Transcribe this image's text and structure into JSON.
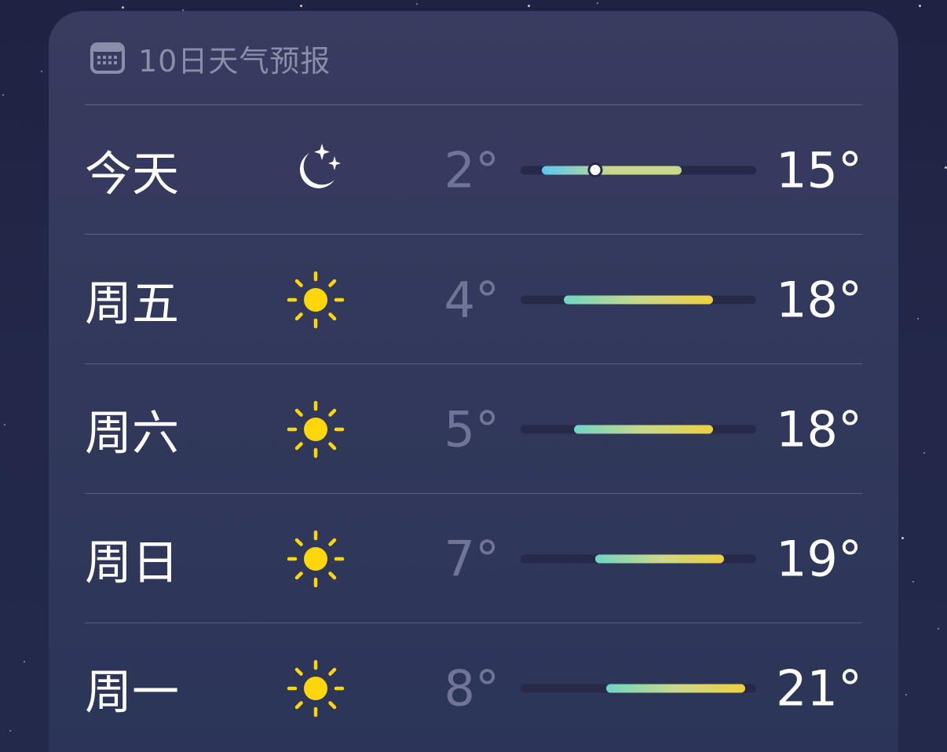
{
  "forecast": {
    "title": "10日天气预报",
    "header_icon": "calendar-icon",
    "scale": {
      "min": 0,
      "max": 22
    },
    "days": [
      {
        "day": "今天",
        "icon": "moon-stars-icon",
        "low": "2°",
        "high": "15°",
        "low_value": 2,
        "high_value": 15,
        "current_value": 7
      },
      {
        "day": "周五",
        "icon": "sun-icon",
        "low": "4°",
        "high": "18°",
        "low_value": 4,
        "high_value": 18
      },
      {
        "day": "周六",
        "icon": "sun-icon",
        "low": "5°",
        "high": "18°",
        "low_value": 5,
        "high_value": 18
      },
      {
        "day": "周日",
        "icon": "sun-icon",
        "low": "7°",
        "high": "19°",
        "low_value": 7,
        "high_value": 19
      },
      {
        "day": "周一",
        "icon": "sun-icon",
        "low": "8°",
        "high": "21°",
        "low_value": 8,
        "high_value": 21
      }
    ]
  },
  "colors": {
    "cool": "#5ac8f0",
    "mild": "#6fd6c4",
    "warm": "#c8d88a",
    "hot": "#f0cf40",
    "sun": "#ffd60a"
  }
}
